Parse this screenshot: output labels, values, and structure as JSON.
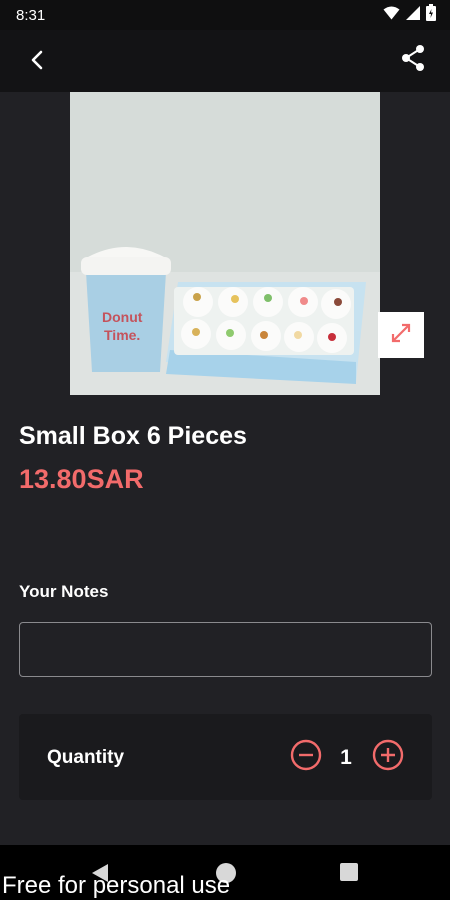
{
  "status_bar": {
    "time": "8:31",
    "icons": [
      "wifi-icon",
      "cellular-signal-icon",
      "battery-icon"
    ]
  },
  "app_bar": {
    "back_icon": "chevron-left-icon",
    "share_icon": "share-icon"
  },
  "product": {
    "image": {
      "cup_text_line1": "Donut",
      "cup_text_line2": "Time."
    },
    "expand_icon": "expand-arrows-icon",
    "title": "Small Box 6 Pieces",
    "price": "13.80SAR"
  },
  "notes": {
    "label": "Your Notes",
    "value": "",
    "placeholder": ""
  },
  "quantity": {
    "label": "Quantity",
    "value": "1",
    "minus_icon": "minus-circle-icon",
    "plus_icon": "plus-circle-icon"
  },
  "nav_bar": {
    "icons": [
      "nav-back-icon",
      "nav-home-icon",
      "nav-recents-icon"
    ]
  },
  "watermark": "Free for personal use",
  "colors": {
    "background": "#212125",
    "app_bar": "#131315",
    "accent": "#f26b6b",
    "card": "#1a1a1d"
  }
}
